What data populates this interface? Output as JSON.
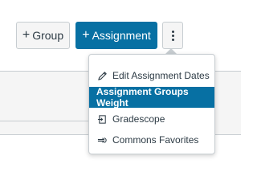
{
  "toolbar": {
    "group_label": "Group",
    "assignment_label": "Assignment",
    "group_icon": "plus-icon",
    "assignment_icon": "plus-icon",
    "more_icon": "kebab-vertical-icon",
    "assignment_color": "#0770a3"
  },
  "menu": {
    "items": [
      {
        "label": "Edit Assignment Dates",
        "icon": "pencil-icon",
        "active": false
      },
      {
        "label": "Assignment Groups Weight",
        "icon": "",
        "active": true
      },
      {
        "label": "Gradescope",
        "icon": "external-tool-icon",
        "active": false
      },
      {
        "label": "Commons Favorites",
        "icon": "commons-icon",
        "active": false
      }
    ],
    "active_color": "#0770a3"
  }
}
